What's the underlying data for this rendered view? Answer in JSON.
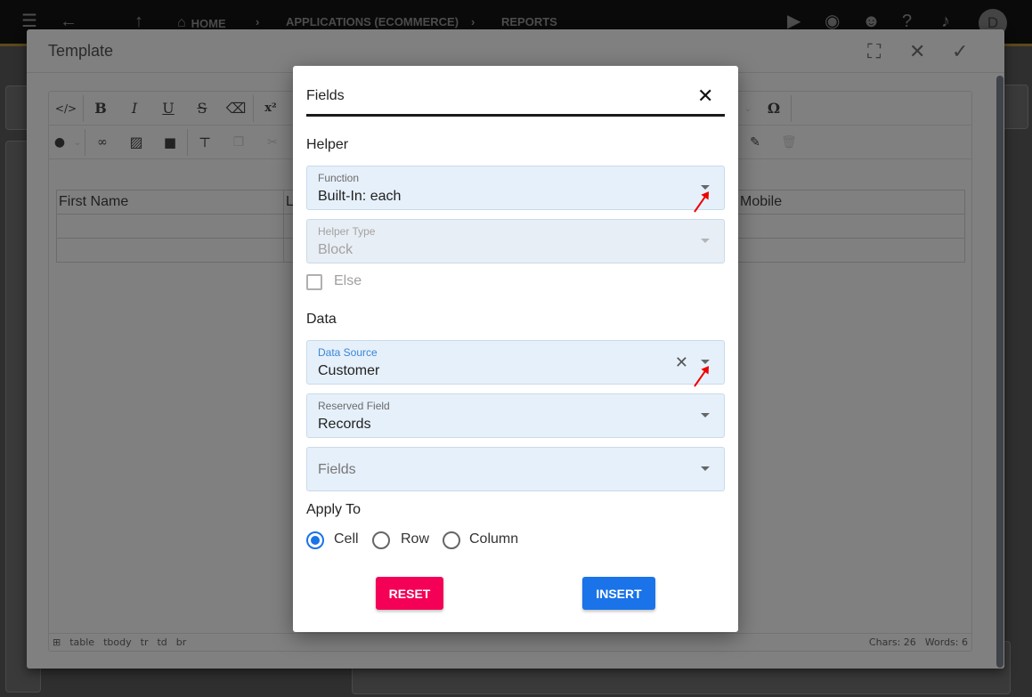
{
  "topbar": {
    "breadcrumbs": [
      "HOME",
      "APPLICATIONS (ECOMMERCE)",
      "REPORTS"
    ],
    "avatar_initial": "D",
    "icons": [
      "menu-icon",
      "back-icon",
      "forward-icon",
      "up-icon",
      "home-icon",
      "play-icon",
      "play-circle-icon",
      "robot-icon",
      "help-icon",
      "bell-icon"
    ]
  },
  "template_dialog": {
    "title": "Template",
    "actions": [
      "fullscreen-icon",
      "close-icon",
      "check-icon"
    ],
    "toolbar_row1": [
      "</>",
      "B",
      "I",
      "U",
      "S",
      "eraser",
      "x²",
      "Ω"
    ],
    "table": {
      "header": [
        "First Name",
        "L",
        "Mobile"
      ],
      "rows": [
        [
          "",
          "",
          ""
        ],
        [
          "",
          "",
          ""
        ]
      ]
    },
    "statusbar": {
      "path": [
        "table",
        "tbody",
        "tr",
        "td",
        "br"
      ],
      "chars": "Chars: 26",
      "words": "Words: 6"
    }
  },
  "fields_dialog": {
    "title": "Fields",
    "helper_section": "Helper",
    "function": {
      "label": "Function",
      "value": "Built-In: each"
    },
    "helper_type": {
      "label": "Helper Type",
      "value": "Block",
      "disabled": true
    },
    "else": {
      "label": "Else",
      "checked": false
    },
    "data_section": "Data",
    "data_source": {
      "label": "Data Source",
      "value": "Customer"
    },
    "reserved_field": {
      "label": "Reserved Field",
      "value": "Records"
    },
    "fields": {
      "placeholder": "Fields"
    },
    "apply_to": {
      "label": "Apply To",
      "options": [
        "Cell",
        "Row",
        "Column"
      ],
      "selected": "Cell"
    },
    "reset_label": "RESET",
    "insert_label": "INSERT"
  },
  "colors": {
    "reset": "#f50057",
    "insert": "#1a73e8",
    "field_bg": "#e6f0fa",
    "annotation": "#ee0000"
  }
}
